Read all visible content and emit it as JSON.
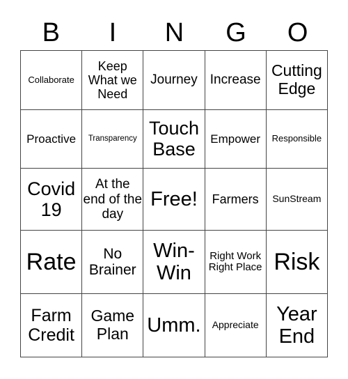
{
  "header": [
    "B",
    "I",
    "N",
    "G",
    "O"
  ],
  "rows": [
    [
      "Collaborate",
      "Keep What we Need",
      "Journey",
      "Increase",
      "Cutting Edge"
    ],
    [
      "Proactive",
      "Transparency",
      "Touch Base",
      "Empower",
      "Responsible"
    ],
    [
      "Covid 19",
      "At the end of the day",
      "Free!",
      "Farmers",
      "SunStream"
    ],
    [
      "Rate",
      "No Brainer",
      "Win-Win",
      "Right Work Right Place",
      "Risk"
    ],
    [
      "Farm Credit",
      "Game Plan",
      "Umm.",
      "Appreciate",
      "Year End"
    ]
  ]
}
